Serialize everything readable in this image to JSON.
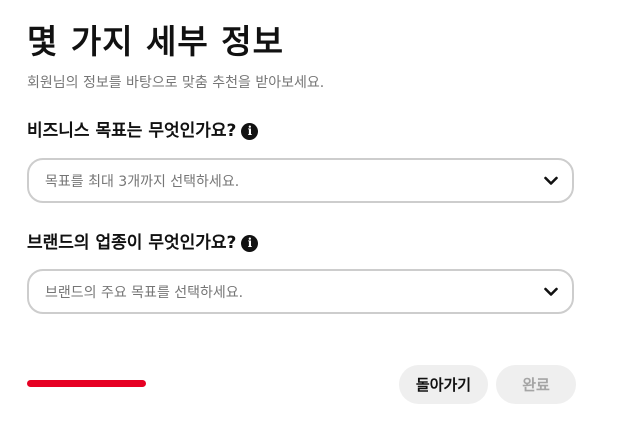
{
  "title": "몇 가지 세부 정보",
  "subtitle": "회원님의 정보를 바탕으로 맞춤 추천을 받아보세요.",
  "questions": [
    {
      "label": "비즈니스 목표는 무엇인가요?",
      "placeholder": "목표를 최대 3개까지 선택하세요.",
      "icons": {
        "info": "info-icon",
        "dropdown": "chevron-down-icon"
      }
    },
    {
      "label": "브랜드의 업종이 무엇인가요?",
      "placeholder": "브랜드의 주요 목표를 선택하세요.",
      "icons": {
        "info": "info-icon",
        "dropdown": "chevron-down-icon"
      }
    }
  ],
  "progress": {
    "fraction": 0.22,
    "color": "#e60023"
  },
  "buttons": {
    "back": "돌아가기",
    "done": "완료"
  },
  "colors": {
    "accent": "#e60023",
    "text": "#111111",
    "muted": "#767676",
    "border": "#cdcdcd",
    "button_bg": "#efefef",
    "disabled_text": "#a5a5a5"
  }
}
